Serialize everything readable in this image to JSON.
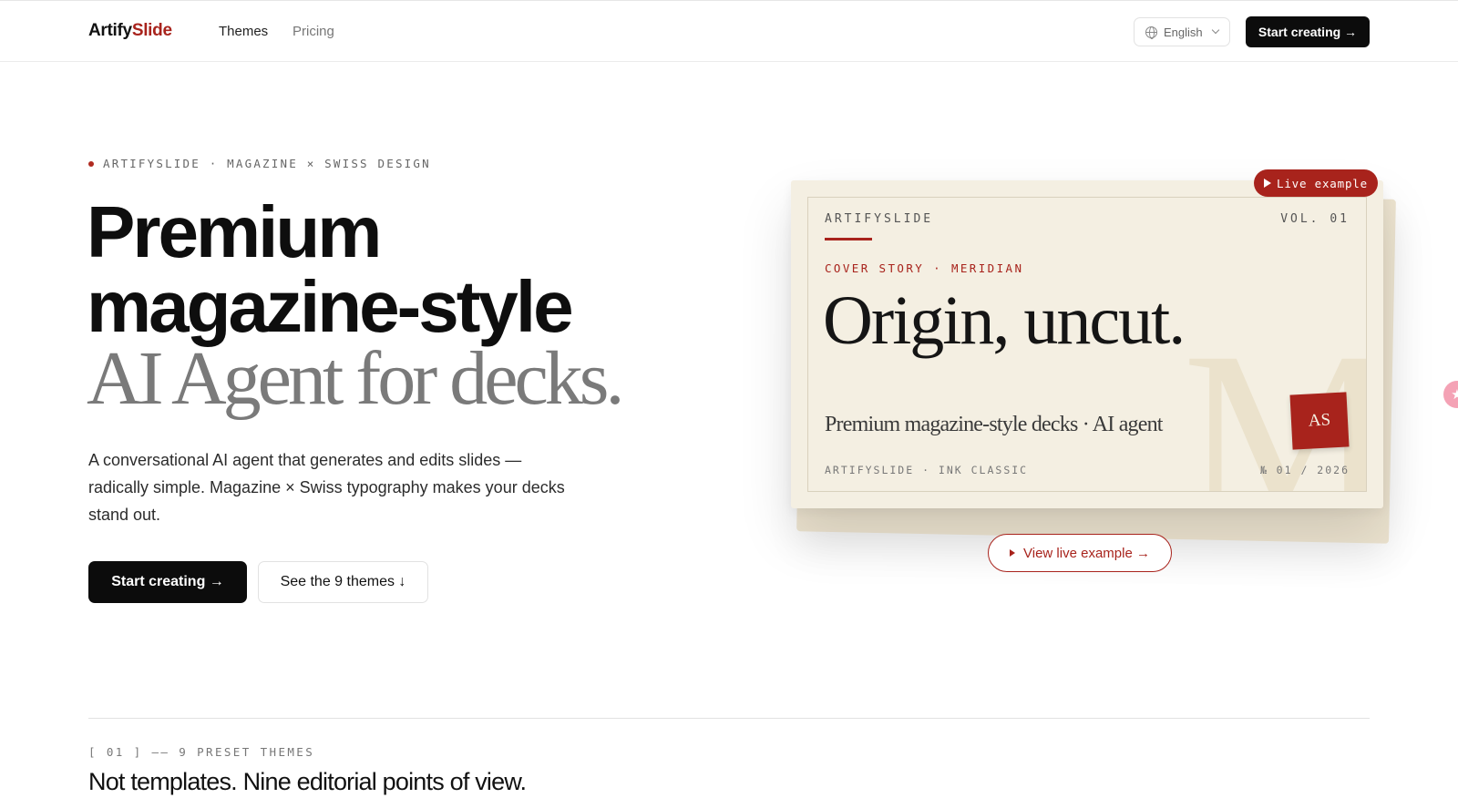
{
  "nav": {
    "logo_part1": "Artify",
    "logo_part2": "Slide",
    "links": [
      "Themes",
      "Pricing"
    ],
    "language": "English",
    "cta": "Start creating →"
  },
  "hero": {
    "eyebrow": "ARTIFYSLIDE · MAGAZINE × SWISS DESIGN",
    "headline_1": "Premium",
    "headline_2": "magazine-style",
    "headline_3": "AI Agent for decks.",
    "lead": "A conversational AI agent that generates and edits slides — radically simple. Magazine × Swiss typography makes your decks stand out.",
    "primary_cta": "Start creating →",
    "secondary_cta": "See the 9 themes ↓"
  },
  "preview_card": {
    "live_badge": "Live example",
    "brand": "ARTIFYSLIDE",
    "volume": "VOL. 01",
    "kicker": "COVER STORY · MERIDIAN",
    "title": "Origin, uncut.",
    "big_letter": "M",
    "subtitle": "Premium magazine-style decks · AI agent",
    "stamp": "AS",
    "footer_left": "ARTIFYSLIDE · INK CLASSIC",
    "footer_right": "№ 01 / 2026",
    "view_button": "View live example →"
  },
  "section": {
    "label": "[ 01 ] —— 9 PRESET THEMES",
    "title": "Not templates. Nine editorial points of view."
  },
  "colors": {
    "accent": "#a8231c",
    "card_bg": "#f4efe2",
    "dark": "#0c0c0c"
  }
}
